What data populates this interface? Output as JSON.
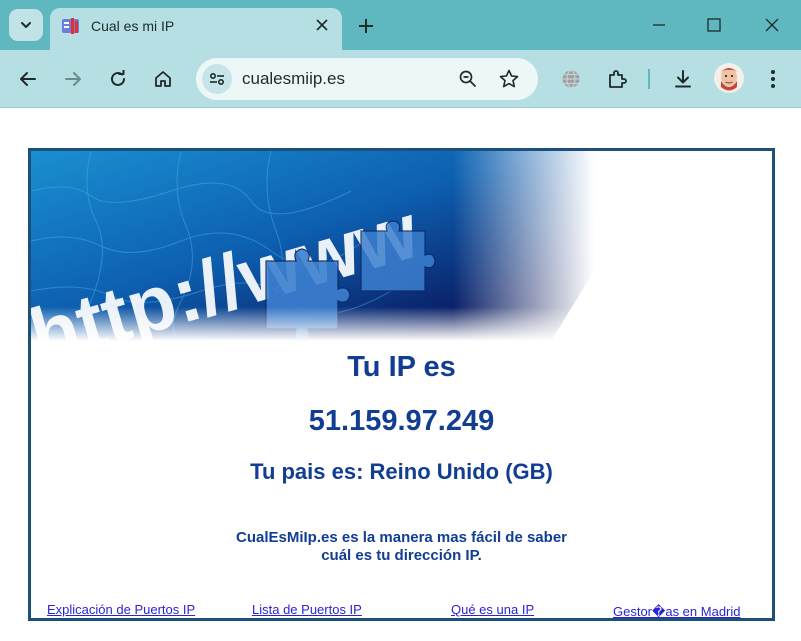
{
  "browser": {
    "tab_title": "Cual es mi IP",
    "url": "cualesmiip.es"
  },
  "page": {
    "banner_alt": "http://www",
    "heading": "Tu IP es",
    "ip": "51.159.97.249",
    "country": "Tu pais es: Reino Unido (GB)",
    "tagline_line1": "CualEsMiIp.es es la manera mas fácil de saber",
    "tagline_line2": "cuál es tu dirección IP.",
    "footer_links": [
      "Explicación de Puertos IP",
      "Lista de Puertos IP",
      "Qué es una IP",
      "Gestor�as en Madrid"
    ]
  },
  "colors": {
    "tabstrip": "#5fb8bf",
    "toolbar": "#b6dfe3",
    "heading_text": "#113d92",
    "frame_border": "#1b4f7c",
    "link": "#2b23d6"
  },
  "icons": [
    "tab-search-icon",
    "favicon-icon",
    "close-icon",
    "plus-icon",
    "minimize-icon",
    "maximize-icon",
    "window-close-icon",
    "back-icon",
    "forward-icon",
    "reload-icon",
    "home-icon",
    "site-info-icon",
    "zoom-icon",
    "star-icon",
    "translate-icon",
    "extensions-icon",
    "download-icon",
    "menu-icon"
  ]
}
